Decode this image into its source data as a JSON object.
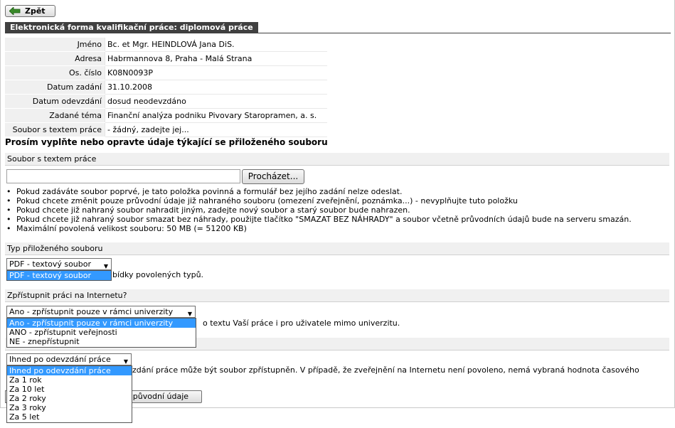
{
  "back_button": {
    "label": "Zpět",
    "icon": "arrow-left-icon"
  },
  "section_title": "Elektronická forma kvalifikační práce: diplomová práce",
  "info_rows": [
    {
      "label": "Jméno",
      "value": "Bc. et Mgr. HEINDLOVÁ Jana DiS."
    },
    {
      "label": "Adresa",
      "value": "Habrmannova 8, Praha - Malá Strana"
    },
    {
      "label": "Os. číslo",
      "value": "K08N0093P"
    },
    {
      "label": "Datum zadání",
      "value": "31.10.2008"
    },
    {
      "label": "Datum odevzdání",
      "value": "dosud neodevzdáno"
    },
    {
      "label": "Zadané téma",
      "value": "Finanční analýza podniku Pivovary Staropramen, a. s."
    },
    {
      "label": "Soubor s textem práce",
      "value": "- žádný, zadejte jej..."
    }
  ],
  "form_heading": "Prosím vyplňte nebo opravte údaje týkající se přiloženého souboru",
  "file_section": {
    "label": "Soubor s textem práce",
    "file_value": "",
    "browse_label": "Procházet...",
    "notes": [
      "Pokud zadáváte soubor poprvé, je tato položka povinná a formulář bez jejího zadání nelze odeslat.",
      "Pokud chcete změnit pouze průvodní údaje již nahraného souboru (omezení zveřejnění, poznámka...) - nevyplňujte tuto položku",
      "Pokud chcete již nahraný soubor nahradit jiným, zadejte nový soubor a starý soubor bude nahrazen.",
      "Pokud chcete již nahraný soubor smazat bez náhrady, použijte tlačítko \"SMAZAT BEZ NÁHRADY\" a soubor včetně průvodních údajů bude na serveru smazán.",
      "Maximální povolená velikost souboru: 50 MB (= 51200 KB)"
    ]
  },
  "file_type": {
    "label": "Typ přiloženého souboru",
    "selected": "PDF - textový soubor",
    "options": [
      "PDF - textový soubor"
    ],
    "help_fragment": "bídky povolených typů."
  },
  "internet_access": {
    "label": "Zpřístupnit práci na Internetu?",
    "selected": "Ano - zpřístupnit pouze v rámci univerzity",
    "options": [
      "Ano - zpřístupnit pouze v rámci univerzity",
      "ANO - zpřístupnit veřejnosti",
      "NE - znepřístupnit"
    ],
    "help_fragment": "o textu Vaší práce i pro uživatele mimo univerzitu."
  },
  "publish_time": {
    "selected": "Ihned po odevzdání práce",
    "options": [
      "Ihned po odevzdání práce",
      "Za 1 rok",
      "Za 10 let",
      "Za 2 roky",
      "Za 3 roky",
      "Za 5 let"
    ],
    "help_fragment": "zdání práce může být soubor zpřístupněn. V případě, že zveřejnění na Internetu není povoleno, nemá vybraná hodnota časového"
  },
  "restore_button": {
    "label": "t původní údaje"
  },
  "colors": {
    "title_bg": "#404040",
    "label_bg": "#f0f0f0",
    "selection": "#3399ff"
  }
}
